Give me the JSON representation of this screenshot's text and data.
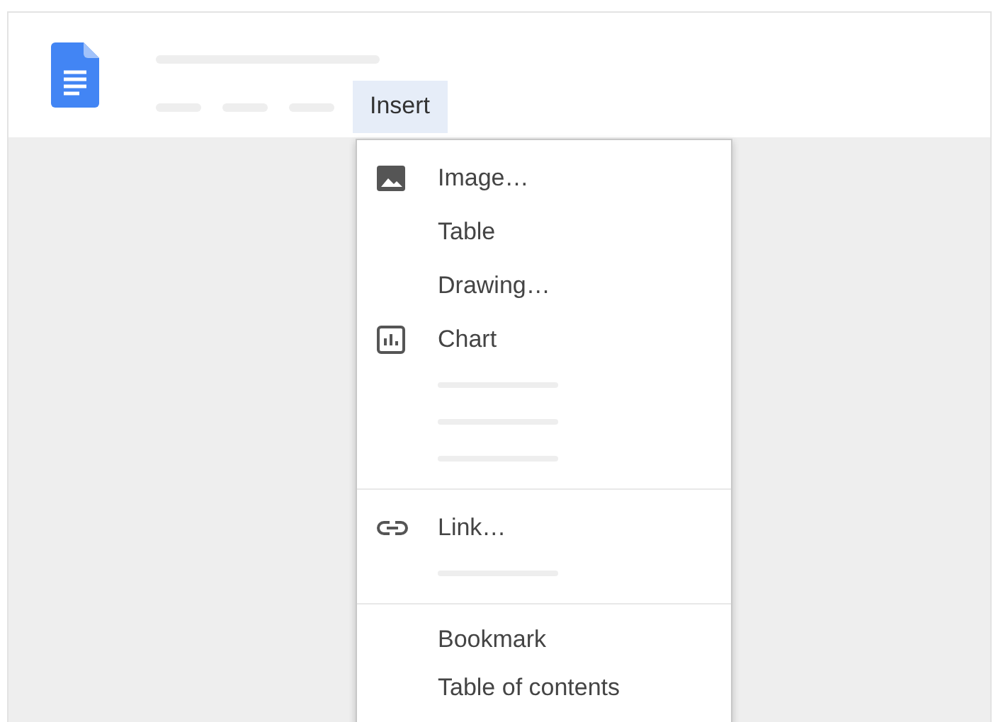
{
  "menu_bar": {
    "label": "Insert",
    "expanded": true
  },
  "menu_groups": [
    {
      "items": [
        {
          "kind": "image",
          "label": "Image…"
        },
        {
          "kind": "plain",
          "label": "Table"
        },
        {
          "kind": "plain",
          "label": "Drawing…"
        },
        {
          "kind": "chart",
          "label": "Chart"
        },
        {
          "kind": "skeleton"
        },
        {
          "kind": "skeleton"
        },
        {
          "kind": "skeleton"
        }
      ]
    },
    {
      "items": [
        {
          "kind": "link",
          "label": "Link…"
        },
        {
          "kind": "skeleton"
        }
      ]
    },
    {
      "items": [
        {
          "kind": "plain",
          "label": "Bookmark"
        },
        {
          "kind": "plain",
          "label": "Table of contents"
        }
      ]
    }
  ]
}
